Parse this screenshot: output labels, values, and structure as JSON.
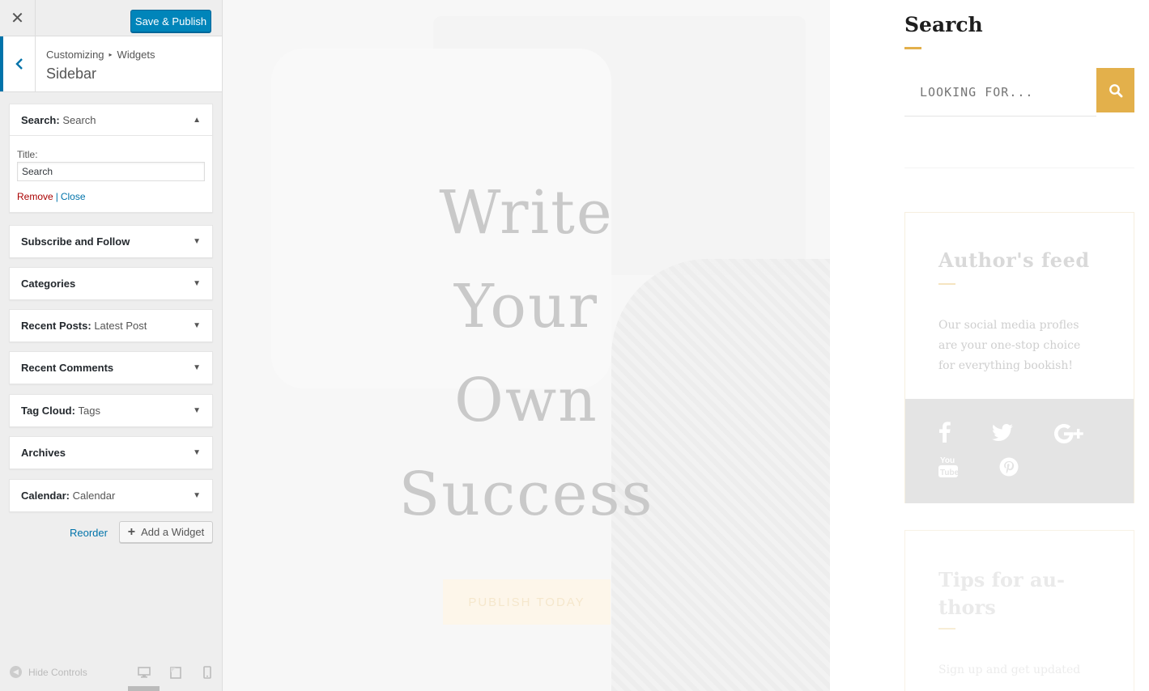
{
  "customizer": {
    "close_label": "✕",
    "save_button": "Save & Publish",
    "breadcrumb": [
      "Customizing",
      "Widgets"
    ],
    "section": "Sidebar",
    "widgets": [
      {
        "name": "Search",
        "in_title": "Search",
        "open": true
      },
      {
        "name": "Subscribe and Follow",
        "in_title": ""
      },
      {
        "name": "Categories",
        "in_title": ""
      },
      {
        "name": "Recent Posts",
        "in_title": "Latest Post"
      },
      {
        "name": "Recent Comments",
        "in_title": ""
      },
      {
        "name": "Tag Cloud",
        "in_title": "Tags"
      },
      {
        "name": "Archives",
        "in_title": ""
      },
      {
        "name": "Calendar",
        "in_title": "Calendar"
      }
    ],
    "search_widget_form": {
      "title_label": "Title:",
      "title_value": "Search",
      "remove_label": "Remove",
      "close_label": "Close"
    },
    "reorder_label": "Reorder",
    "add_widget_label": "Add a Widget",
    "hide_controls_label": "Hide Controls"
  },
  "preview": {
    "hero": {
      "headline_lines": [
        "Write",
        "Your",
        "Own",
        "Success"
      ],
      "cta_label": "PUBLISH TODAY"
    },
    "sidebar": {
      "search_title": "Search",
      "search_placeholder": "LOOKING FOR...",
      "author_feed": {
        "title": "Author's feed",
        "description": "Our social media profles are your one-stop choice for everything bookish!",
        "social": [
          "facebook",
          "twitter",
          "google-plus",
          "youtube",
          "pinterest"
        ]
      },
      "tips": {
        "title": "Tips for au-thors",
        "description": "Sign up and get updated"
      }
    }
  },
  "colors": {
    "wp_blue": "#0085ba",
    "accent_gold": "#e3b04b",
    "remove_red": "#aa0000"
  }
}
